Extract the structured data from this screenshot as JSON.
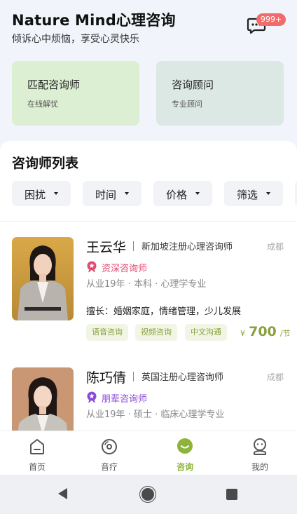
{
  "header": {
    "title": "Nature Mind心理咨询",
    "subtitle": "倾诉心中烦恼，享受心灵快乐",
    "message_badge": "999+"
  },
  "cards": [
    {
      "title": "匹配咨询师",
      "subtitle": "在线解忧"
    },
    {
      "title": "咨询顾问",
      "subtitle": "专业顾问"
    }
  ],
  "list": {
    "title": "咨询师列表",
    "filters": [
      "困扰",
      "时间",
      "价格",
      "筛选"
    ]
  },
  "counselors": [
    {
      "name": "王云华",
      "cert": "新加坡注册心理咨询师",
      "city": "成都",
      "level": "资深咨询师",
      "level_color": "#e2496f",
      "meta": "从业19年 · 本科 · 心理学专业",
      "skills": "擅长：婚姻家庭，情绪管理，少儿发展",
      "tags": [
        "语音咨询",
        "视频咨询",
        "中文沟通"
      ],
      "price_currency": "¥",
      "price": "700",
      "price_unit": "/节"
    },
    {
      "name": "陈巧倩",
      "cert": "英国注册心理咨询师",
      "city": "成都",
      "level": "朋辈咨询师",
      "level_color": "#8d49d6",
      "meta": "从业19年 · 硕士 · 临床心理学专业"
    }
  ],
  "tabs": [
    {
      "label": "首页",
      "icon": "home-icon"
    },
    {
      "label": "音疗",
      "icon": "music-disc-icon"
    },
    {
      "label": "咨询",
      "icon": "smile-icon",
      "active": true
    },
    {
      "label": "我的",
      "icon": "profile-icon"
    }
  ],
  "colors": {
    "accent": "#8db33b",
    "badge": "#f26b6b",
    "card_green": "#dcefd3",
    "card_teal": "#dce8e3"
  }
}
